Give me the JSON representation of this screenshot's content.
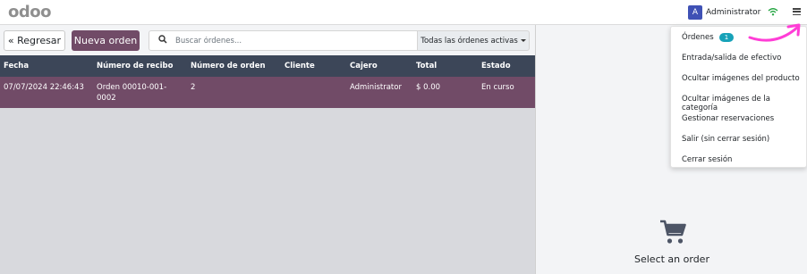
{
  "header": {
    "logo": "odoo",
    "user": {
      "initial": "A",
      "name": "Administrator"
    },
    "icons": {
      "status": "wifi-icon",
      "menu": "hamburger-menu-icon"
    }
  },
  "toolbar": {
    "back_label": "« Regresar",
    "new_order_label": "Nueva orden",
    "search_placeholder": "Buscar órdenes...",
    "filter_label": "Todas las órdenes activas"
  },
  "table": {
    "columns": [
      "Fecha",
      "Número de recibo",
      "Número de orden",
      "Cliente",
      "Cajero",
      "Total",
      "Estado"
    ],
    "rows": [
      {
        "fecha": "07/07/2024 22:46:43",
        "recibo": "Orden 00010-001-0002",
        "orden": "2",
        "cliente": "",
        "cajero": "Administrator",
        "total": "$ 0.00",
        "estado": "En curso"
      }
    ]
  },
  "dropdown_menu": {
    "items": [
      {
        "label": "Órdenes",
        "badge": "1"
      },
      {
        "label": "Entrada/salida de efectivo"
      },
      {
        "label": "Ocultar imágenes del producto"
      },
      {
        "label": "Ocultar imágenes de la categoría"
      },
      {
        "label": "Gestionar reservaciones"
      },
      {
        "label": "Salir (sin cerrar sesión)"
      },
      {
        "label": "Cerrar sesión"
      }
    ]
  },
  "order_panel": {
    "empty_text": "Select an order",
    "icon": "shopping-cart-icon"
  },
  "colors": {
    "brand": "#714b67",
    "table_header": "#3c4658",
    "avatar": "#3f51b5",
    "badge": "#17a2b8",
    "wifi": "#28a745",
    "annotation_arrow": "#ff3dd6"
  }
}
